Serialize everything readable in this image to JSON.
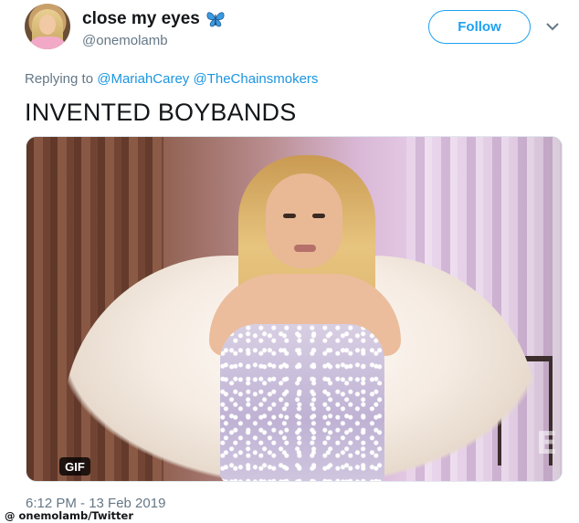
{
  "header": {
    "display_name": "close my eyes",
    "handle": "@onemolamb",
    "follow_label": "Follow",
    "name_emoji": "butterfly-icon",
    "accent_color": "#1da1f2"
  },
  "reply": {
    "prefix": "Replying to",
    "mentions": [
      "@MariahCarey",
      "@TheChainsmokers"
    ]
  },
  "tweet": {
    "text": "INVENTED BOYBANDS"
  },
  "media": {
    "badge": "GIF",
    "watermark": "E"
  },
  "meta": {
    "timestamp": "6:12 PM - 13 Feb 2019"
  },
  "credit": {
    "text": "@ onemolamb/Twitter"
  }
}
